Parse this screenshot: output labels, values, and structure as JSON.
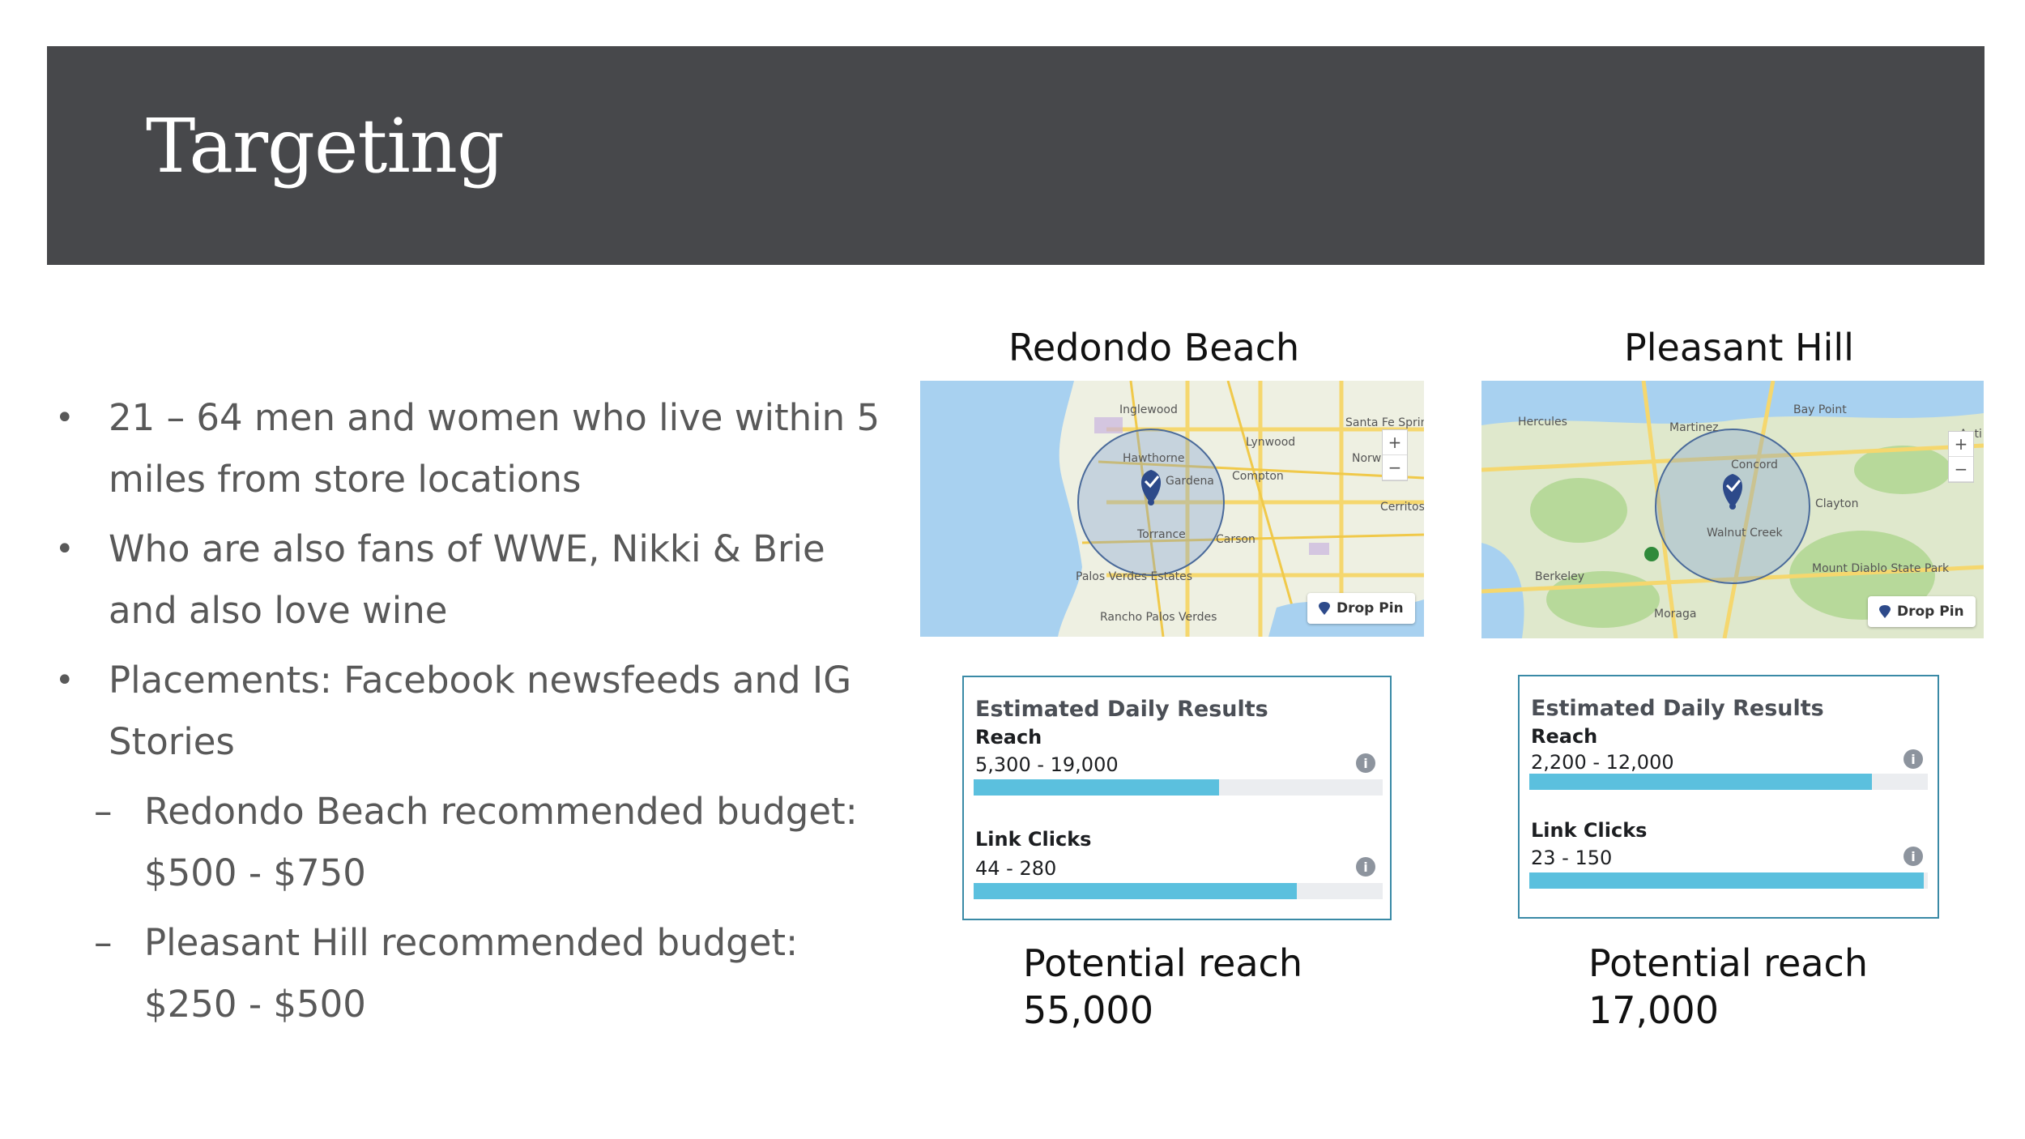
{
  "slide": {
    "title": "Targeting"
  },
  "bullets": [
    {
      "text": "21 – 64 men and women who live within 5 miles from store locations"
    },
    {
      "text": "Who are also fans of WWE, Nikki & Brie and also love wine"
    },
    {
      "text": "Placements: Facebook newsfeeds and IG Stories"
    }
  ],
  "sub_bullets": [
    {
      "text": "Redondo Beach recommended budget: $500 - $750"
    },
    {
      "text": "Pleasant Hill recommended budget: $250 - $500"
    }
  ],
  "bullet_glyph": "•",
  "dash_glyph": "–",
  "locations": [
    {
      "name": "Redondo Beach",
      "map_labels": [
        "Inglewood",
        "Hawthorne",
        "Gardena",
        "Lynwood",
        "Compton",
        "Torrance",
        "Carson",
        "Palos Verdes Estates",
        "Rancho Palos Verdes",
        "Santa Fe Sprin",
        "Norw",
        "Cerritos"
      ],
      "drop_pin": "Drop Pin",
      "results": {
        "title": "Estimated Daily Results",
        "reach_label": "Reach",
        "reach_value": "5,300 - 19,000",
        "reach_fill": 0.6,
        "clicks_label": "Link Clicks",
        "clicks_value": "44 - 280",
        "clicks_fill": 0.79
      },
      "potential_label": "Potential reach",
      "potential_value": "55,000"
    },
    {
      "name": "Pleasant Hill",
      "map_labels": [
        "Hercules",
        "Martinez",
        "Bay Point",
        "Concord",
        "Clayton",
        "Walnut Creek",
        "Berkeley",
        "Moraga",
        "Mount Diablo State Park",
        "Anti"
      ],
      "drop_pin": "Drop Pin",
      "results": {
        "title": "Estimated Daily Results",
        "reach_label": "Reach",
        "reach_value": "2,200 - 12,000",
        "reach_fill": 0.86,
        "clicks_label": "Link Clicks",
        "clicks_value": "23 - 150",
        "clicks_fill": 0.99
      },
      "potential_label": "Potential reach",
      "potential_value": "17,000"
    }
  ],
  "icons": {
    "info": "i",
    "zoom_in": "+",
    "zoom_out": "−"
  },
  "colors": {
    "header_bg": "#47484b",
    "bar_fill": "#5bc0de",
    "box_border": "#3a8aa6",
    "pin": "#2d4a8a"
  }
}
